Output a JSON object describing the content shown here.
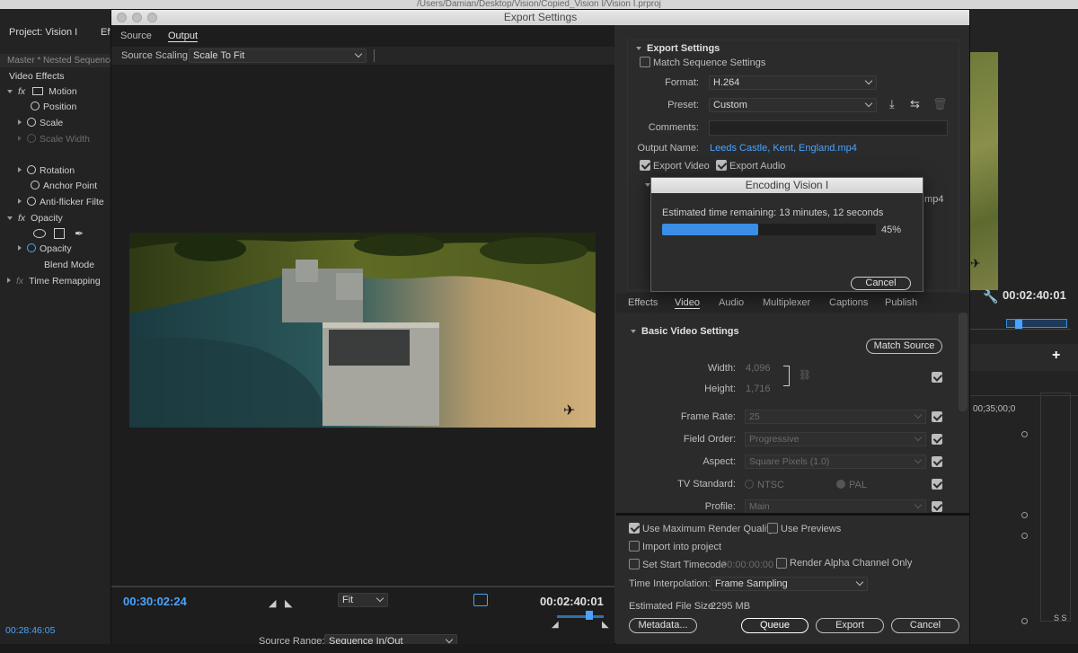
{
  "os": {
    "path": "/Users/Damian/Desktop/Vision/Copied_Vision I/Vision I.prproj"
  },
  "left_panel": {
    "project_label": "Project: Vision I",
    "project_tab2": "Eff",
    "master_label": "Master * Nested Sequence",
    "video_effects": "Video Effects",
    "fx": [
      "Motion",
      "Position",
      "Scale",
      "Scale Width",
      "Rotation",
      "Anchor Point",
      "Anti-flicker Filte",
      "Opacity",
      "Opacity",
      "Blend Mode",
      "Time Remapping"
    ],
    "timecode": "00:28:46:05"
  },
  "dialog": {
    "title": "Export Settings",
    "tabs": [
      "Source",
      "Output"
    ],
    "source_scaling_label": "Source Scaling:",
    "source_scaling_value": "Scale To Fit",
    "current_time": "00:30:02:24",
    "fit": "Fit",
    "duration": "00:02:40:01",
    "source_range_label": "Source Range:",
    "source_range_value": "Sequence In/Out"
  },
  "export_settings": {
    "section": "Export Settings",
    "match_sequence": "Match Sequence Settings",
    "format_label": "Format:",
    "format_value": "H.264",
    "preset_label": "Preset:",
    "preset_value": "Custom",
    "comments_label": "Comments:",
    "output_name_label": "Output Name:",
    "output_name_value": "Leeds Castle, Kent, England.mp4",
    "export_video": "Export Video",
    "export_audio": "Export Audio",
    "summary_trunc": ".mp4"
  },
  "settings_tabs": [
    "Effects",
    "Video",
    "Audio",
    "Multiplexer",
    "Captions",
    "Publish"
  ],
  "basic_video": {
    "section": "Basic Video Settings",
    "match_source": "Match Source",
    "width_label": "Width:",
    "width_value": "4,096",
    "height_label": "Height:",
    "height_value": "1,716",
    "frame_rate_label": "Frame Rate:",
    "frame_rate_value": "25",
    "field_order_label": "Field Order:",
    "field_order_value": "Progressive",
    "aspect_label": "Aspect:",
    "aspect_value": "Square Pixels (1.0)",
    "tv_standard_label": "TV Standard:",
    "tv_ntsc": "NTSC",
    "tv_pal": "PAL",
    "profile_label": "Profile:",
    "profile_value": "Main"
  },
  "bottom_options": {
    "max_render": "Use Maximum Render Quality",
    "use_previews": "Use Previews",
    "import_project": "Import into project",
    "set_start_tc": "Set Start Timecode",
    "start_tc_value": "00:00:00:00",
    "render_alpha": "Render Alpha Channel Only",
    "time_interp_label": "Time Interpolation:",
    "time_interp_value": "Frame Sampling",
    "file_size_label": "Estimated File Size:",
    "file_size_value": "2295 MB",
    "metadata": "Metadata...",
    "queue": "Queue",
    "export": "Export",
    "cancel": "Cancel"
  },
  "encoding": {
    "title": "Encoding Vision I",
    "remaining": "Estimated time remaining: 13 minutes, 12 seconds",
    "progress": 0.45,
    "percent": "45%",
    "cancel": "Cancel"
  },
  "right_panel": {
    "timecode": "00:02:40:01",
    "ruler": "00;35;00;0",
    "ss": "S S"
  },
  "colors": {
    "accent": "#4aa3ff",
    "progress": "#3a8ee6"
  }
}
